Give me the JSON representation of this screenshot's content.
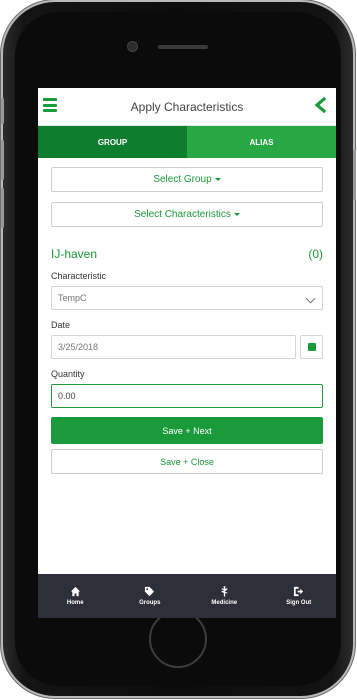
{
  "header": {
    "title": "Apply Characteristics"
  },
  "tabs": [
    {
      "label": "GROUP"
    },
    {
      "label": "ALIAS"
    }
  ],
  "form": {
    "select_group_label": "Select Group",
    "select_characteristics_label": "Select Characteristics",
    "section_name": "IJ-haven",
    "section_count": "(0)",
    "characteristic_label": "Characteristic",
    "characteristic_value": "TempC",
    "date_label": "Date",
    "date_value": "3/25/2018",
    "quantity_label": "Quantity",
    "quantity_value": "0.00",
    "save_next_label": "Save + Next",
    "save_close_label": "Save + Close"
  },
  "bottom_nav": [
    {
      "label": "Home",
      "icon": "home-icon"
    },
    {
      "label": "Groups",
      "icon": "tag-icon"
    },
    {
      "label": "Medicine",
      "icon": "caduceus-icon"
    },
    {
      "label": "Sign Out",
      "icon": "sign-out-icon"
    }
  ],
  "colors": {
    "primary": "#1a9a3a",
    "tab_active": "#0f7d2e",
    "tab_inactive": "#27a844",
    "nav_bg": "#2f2f3a"
  }
}
